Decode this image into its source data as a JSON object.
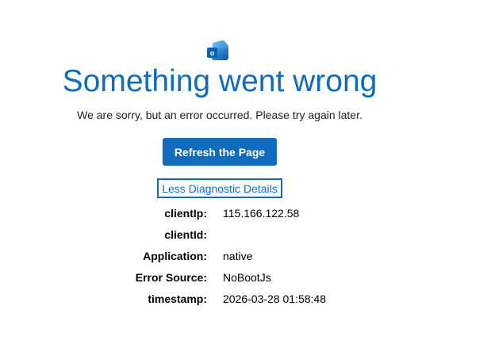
{
  "app": {
    "logo_icon": "outlook-logo-icon"
  },
  "error": {
    "title": "Something went wrong",
    "message": "We are sorry, but an error occurred. Please try again later."
  },
  "actions": {
    "refresh_label": "Refresh the Page",
    "diagnostics_toggle_label": "Less Diagnostic Details"
  },
  "diagnostics": [
    {
      "key": "clientIp:",
      "value": "115.166.122.58"
    },
    {
      "key": "clientId:",
      "value": ""
    },
    {
      "key": "Application:",
      "value": "native"
    },
    {
      "key": "Error Source:",
      "value": "NoBootJs"
    },
    {
      "key": "timestamp:",
      "value": "2026-03-28 01:58:48"
    }
  ],
  "colors": {
    "accent": "#0f6cbd",
    "text": "#201f1e"
  }
}
